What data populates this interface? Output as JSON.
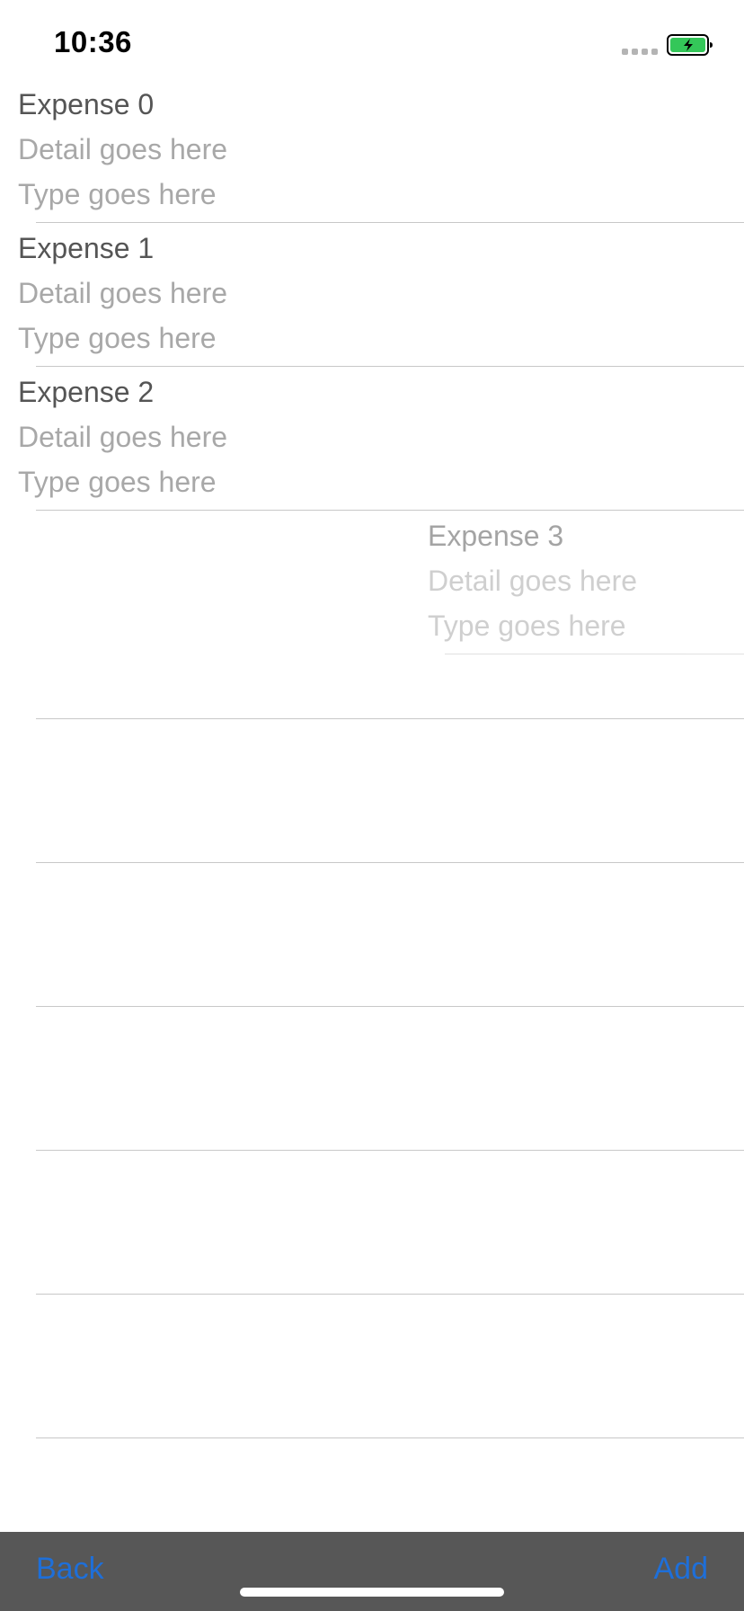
{
  "status_bar": {
    "time": "10:36",
    "battery_color": "#34c759"
  },
  "expenses": [
    {
      "title": "Expense 0",
      "detail": "Detail goes here",
      "type": "Type goes here"
    },
    {
      "title": "Expense 1",
      "detail": "Detail goes here",
      "type": "Type goes here"
    },
    {
      "title": "Expense 2",
      "detail": "Detail goes here",
      "type": "Type goes here"
    }
  ],
  "dragging_expense": {
    "title": "Expense 3",
    "detail": "Detail goes here",
    "type": "Type goes here"
  },
  "toolbar": {
    "back_label": "Back",
    "add_label": "Add",
    "accent_color": "#1e6fd9",
    "background_color": "#575757"
  }
}
